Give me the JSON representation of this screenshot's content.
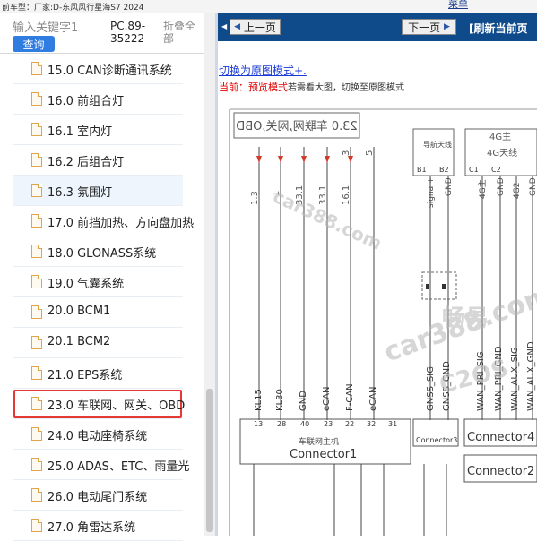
{
  "topbar": {
    "car_label": "前车型：厂家:D-东风风行星海S7 2024",
    "top_link": "菜单"
  },
  "search": {
    "placeholder": "输入关键字1",
    "query_label": "查询",
    "pc_code": "PC.89-35222",
    "fold_all": "折叠全部"
  },
  "tree": {
    "items": [
      {
        "label": "15.0 CAN诊断通讯系统"
      },
      {
        "label": "16.0 前组合灯"
      },
      {
        "label": "16.1 室内灯"
      },
      {
        "label": "16.2 后组合灯"
      },
      {
        "label": "16.3 氛围灯"
      },
      {
        "label": "17.0 前挡加热、方向盘加热"
      },
      {
        "label": "18.0 GLONASS系统"
      },
      {
        "label": "19.0 气囊系统"
      },
      {
        "label": "20.0 BCM1"
      },
      {
        "label": "20.1 BCM2"
      },
      {
        "label": "21.0 EPS系统"
      },
      {
        "label": "23.0 车联网、网关、OBD"
      },
      {
        "label": "24.0 电动座椅系统"
      },
      {
        "label": "25.0 ADAS、ETC、雨量光"
      },
      {
        "label": "26.0 电动尾门系统"
      },
      {
        "label": "27.0 角雷达系统"
      }
    ]
  },
  "nav": {
    "prev_label": "上一页",
    "next_label": "下一页",
    "refresh_label": "[刷新当前页"
  },
  "viewer": {
    "switch_link": "切换为原图模式+.",
    "mode_now": "当前：",
    "mode_preview": "预览模式",
    "mode_hint": "若需看大图，切换至原图模式"
  },
  "diagram": {
    "title_box": "23.0 车联网,网关,OBD",
    "watermarks": [
      "car388.com",
      "畅易",
      "car388.com",
      "C2OS"
    ],
    "pin_labels_left": [
      "1.3",
      "1",
      "33.1",
      "33.1",
      "3",
      "16.1",
      "5"
    ],
    "connector_names": [
      "Connector1",
      "Connector2",
      "Connector3",
      "Connector4"
    ],
    "connector_header": "车联网主机",
    "modules": [
      "导航天线",
      "4G主",
      "4G天线"
    ],
    "pin_bottom_labels": [
      "KL15",
      "KL30",
      "GND",
      "eCAN",
      "F-CAN",
      "eCAN"
    ],
    "pin_numbers": [
      "13",
      "28",
      "40",
      "23",
      "22",
      "32",
      "31"
    ],
    "right_pins": [
      "B1",
      "B2",
      "C1",
      "C2"
    ],
    "gnss_labels": [
      "GNSS_SIG",
      "GNSS_GND"
    ],
    "wan_labels": [
      "WAN_PRI_SIG",
      "WAN_PRI_GND",
      "WAN_AUX_SIG",
      "WAN_AUX_GND"
    ],
    "signal_labels": [
      "signal+",
      "GND",
      "4G主",
      "GND",
      "4G2",
      "GND"
    ]
  }
}
